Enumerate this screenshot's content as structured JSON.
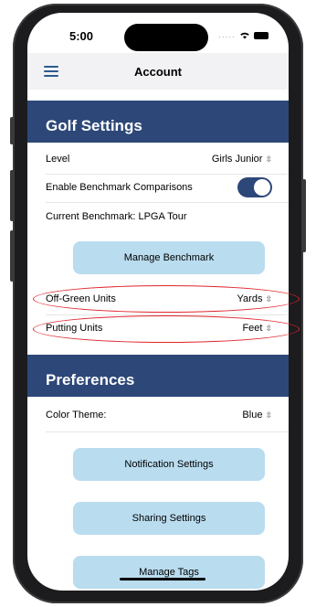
{
  "status_bar": {
    "time": "5:00",
    "signal": "....."
  },
  "nav": {
    "title": "Account"
  },
  "golf_settings": {
    "title": "Golf Settings",
    "level": {
      "label": "Level",
      "value": "Girls Junior"
    },
    "benchmark_toggle": {
      "label": "Enable Benchmark Comparisons",
      "enabled": true
    },
    "current_benchmark": {
      "label": "Current Benchmark: LPGA Tour"
    },
    "manage_benchmark_button": "Manage Benchmark",
    "off_green_units": {
      "label": "Off-Green Units",
      "value": "Yards"
    },
    "putting_units": {
      "label": "Putting Units",
      "value": "Feet"
    }
  },
  "preferences": {
    "title": "Preferences",
    "color_theme": {
      "label": "Color Theme:",
      "value": "Blue"
    },
    "notification_button": "Notification Settings",
    "sharing_button": "Sharing Settings",
    "manage_tags_button": "Manage Tags"
  },
  "colors": {
    "accent": "#2d4778",
    "button_bg": "#b9dcef",
    "highlight": "#e0242b"
  },
  "icons": {
    "menu": "hamburger-icon",
    "wifi": "wifi-icon",
    "battery": "battery-icon",
    "chevron": "updown-chevron-icon"
  }
}
